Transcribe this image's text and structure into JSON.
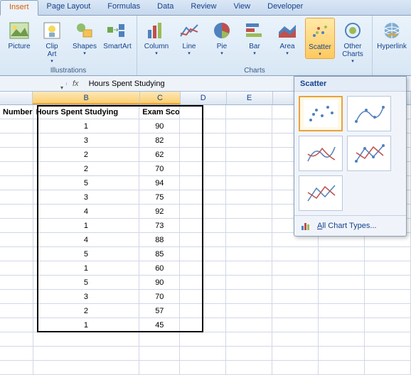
{
  "tabs": {
    "insert": "Insert",
    "page_layout": "Page Layout",
    "formulas": "Formulas",
    "data": "Data",
    "review": "Review",
    "view": "View",
    "developer": "Developer"
  },
  "ribbon": {
    "illustrations": {
      "label": "Illustrations",
      "picture": "Picture",
      "clipart": "Clip\nArt",
      "shapes": "Shapes",
      "smartart": "SmartArt"
    },
    "charts": {
      "label": "Charts",
      "column": "Column",
      "line": "Line",
      "pie": "Pie",
      "bar": "Bar",
      "area": "Area",
      "scatter": "Scatter",
      "other": "Other\nCharts"
    },
    "links": {
      "hyperlink": "Hyperlink"
    }
  },
  "formula_bar": {
    "fx": "fx",
    "text": "Hours Spent Studying"
  },
  "columns": {
    "A": "Number",
    "B": "B",
    "C": "C",
    "D": "D",
    "E": "E"
  },
  "headers": {
    "b": "Hours Spent Studying",
    "c": "Exam Score"
  },
  "rows": [
    {
      "b": "1",
      "c": "90"
    },
    {
      "b": "3",
      "c": "82"
    },
    {
      "b": "2",
      "c": "62"
    },
    {
      "b": "2",
      "c": "70"
    },
    {
      "b": "5",
      "c": "94"
    },
    {
      "b": "3",
      "c": "75"
    },
    {
      "b": "4",
      "c": "92"
    },
    {
      "b": "1",
      "c": "73"
    },
    {
      "b": "4",
      "c": "88"
    },
    {
      "b": "5",
      "c": "85"
    },
    {
      "b": "1",
      "c": "60"
    },
    {
      "b": "5",
      "c": "90"
    },
    {
      "b": "3",
      "c": "70"
    },
    {
      "b": "2",
      "c": "57"
    },
    {
      "b": "1",
      "c": "45"
    }
  ],
  "popup": {
    "title": "Scatter",
    "all": "All Chart Types..."
  },
  "chart_data": {
    "type": "scatter",
    "x": [
      1,
      3,
      2,
      2,
      5,
      3,
      4,
      1,
      4,
      5,
      1,
      5,
      3,
      2,
      1
    ],
    "y": [
      90,
      82,
      62,
      70,
      94,
      75,
      92,
      73,
      88,
      85,
      60,
      90,
      70,
      57,
      45
    ],
    "xlabel": "Hours Spent Studying",
    "ylabel": "Exam Score"
  }
}
